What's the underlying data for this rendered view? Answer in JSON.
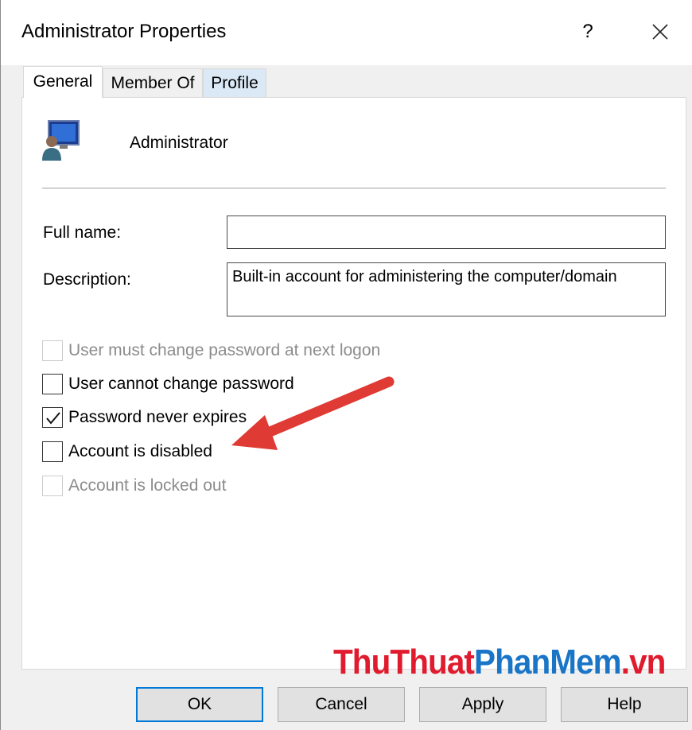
{
  "window": {
    "title": "Administrator Properties"
  },
  "titlebar": {
    "help_label": "?"
  },
  "tabs": [
    {
      "label": "General"
    },
    {
      "label": "Member Of"
    },
    {
      "label": "Profile"
    }
  ],
  "general": {
    "username": "Administrator",
    "full_name_label": "Full name:",
    "full_name_value": "",
    "description_label": "Description:",
    "description_value": "Built-in account for administering the computer/domain",
    "checkboxes": [
      {
        "label": "User must change password at next logon",
        "checked": false,
        "enabled": false
      },
      {
        "label": "User cannot change password",
        "checked": false,
        "enabled": true
      },
      {
        "label": "Password never expires",
        "checked": true,
        "enabled": true
      },
      {
        "label": "Account is disabled",
        "checked": false,
        "enabled": true
      },
      {
        "label": "Account is locked out",
        "checked": false,
        "enabled": false
      }
    ]
  },
  "watermark": {
    "part1": "ThuThuat",
    "part2": "PhanMem",
    "part3": ".vn"
  },
  "buttons": {
    "ok": "OK",
    "cancel": "Cancel",
    "apply": "Apply",
    "help": "Help"
  },
  "colors": {
    "accent": "#0078d7",
    "arrow": "#e03a34",
    "watermark_red": "#e01b2e",
    "watermark_blue": "#1a75c7"
  }
}
